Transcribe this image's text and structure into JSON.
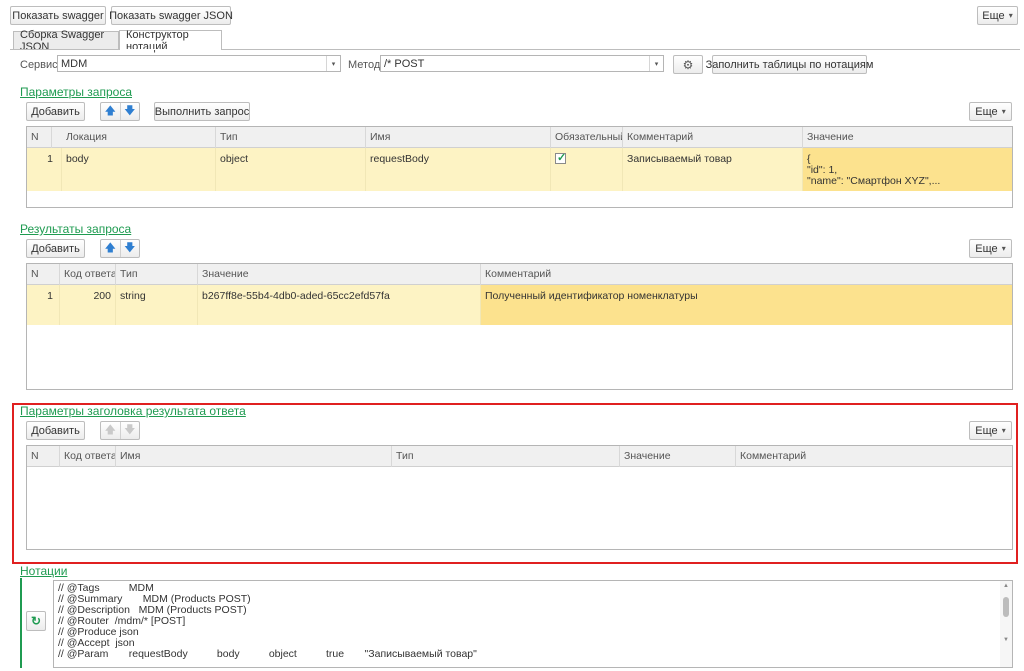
{
  "toolbar": {
    "show_swagger": "Показать swagger",
    "show_swagger_json": "Показать swagger JSON",
    "more": "Еще"
  },
  "tabs": [
    {
      "label": "Сборка Swagger JSON"
    },
    {
      "label": "Конструктор нотаций"
    }
  ],
  "filters": {
    "service_label": "Сервис:",
    "service_value": "MDM",
    "method_label": "Метод:",
    "method_value": "/* POST",
    "fill_button": "Заполнить таблицы по нотациям"
  },
  "request_params": {
    "title": "Параметры запроса",
    "add": "Добавить",
    "execute": "Выполнить запрос",
    "more": "Еще",
    "columns": [
      "N",
      "Локация",
      "Тип",
      "Имя",
      "Обязательный",
      "Комментарий",
      "Значение"
    ],
    "rows": [
      {
        "n": "1",
        "location": "body",
        "type": "object",
        "name": "requestBody",
        "required": true,
        "comment": "Записываемый товар",
        "value": [
          "{",
          "\"id\":  1,",
          "\"name\":  \"Смартфон XYZ\",..."
        ]
      }
    ]
  },
  "request_results": {
    "title": "Результаты запроса",
    "add": "Добавить",
    "more": "Еще",
    "columns": [
      "N",
      "Код ответа",
      "Тип",
      "Значение",
      "Комментарий"
    ],
    "rows": [
      {
        "n": "1",
        "code": "200",
        "type": "string",
        "value": "b267ff8e-55b4-4db0-aded-65cc2efd57fa",
        "comment": "Полученный идентификатор номенклатуры"
      }
    ]
  },
  "response_headers": {
    "title": "Параметры заголовка результата ответа",
    "add": "Добавить",
    "more": "Еще",
    "columns": [
      "N",
      "Код ответа",
      "Имя",
      "Тип",
      "Значение",
      "Комментарий"
    ]
  },
  "notations": {
    "title": "Нотации",
    "lines": [
      "// @Tags          MDM",
      "// @Summary       MDM (Products POST)",
      "// @Description   MDM (Products POST)",
      "// @Router  /mdm/* [POST]",
      "// @Produce json",
      "// @Accept  json",
      "// @Param       requestBody          body          object          true       \"Записываемый товар\""
    ]
  },
  "colors": {
    "accent_green": "#1f9b51",
    "row_yellow": "#fdf3c4",
    "row_selected": "#fce28e",
    "highlight_red": "#e02020",
    "arrow_blue": "#2f7fd1"
  }
}
